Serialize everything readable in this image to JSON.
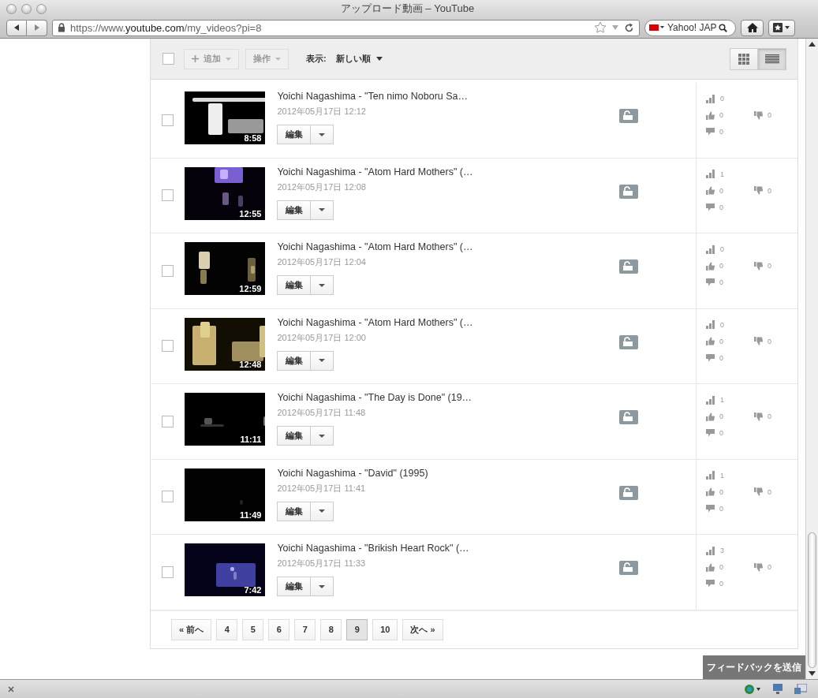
{
  "window": {
    "title": "アップロード動画 – YouTube"
  },
  "browser": {
    "url": "https://www.**youtube.com**/my_videos?pi=8",
    "search": "Yahoo! JAP"
  },
  "toolbar": {
    "select_all_checked": false,
    "add": "追加",
    "actions": "操作",
    "sort_label": "表示:",
    "sort": "新しい順",
    "views": [
      {
        "kind": "grid",
        "selected": false
      },
      {
        "kind": "list",
        "selected": true
      }
    ]
  },
  "videos": [
    {
      "title": "Yoichi Nagashima - \"Ten nimo Noboru Sa…",
      "date": "2012年05月17日 12:12",
      "duration": "8:58",
      "edit": "編集",
      "views": "0",
      "likes": "0",
      "dislikes": "0",
      "comments": "0",
      "checked": false
    },
    {
      "title": "Yoichi Nagashima - \"Atom Hard Mothers\" (…",
      "date": "2012年05月17日 12:08",
      "duration": "12:55",
      "edit": "編集",
      "views": "1",
      "likes": "0",
      "dislikes": "0",
      "comments": "0",
      "checked": false
    },
    {
      "title": "Yoichi Nagashima - \"Atom Hard Mothers\" (…",
      "date": "2012年05月17日 12:04",
      "duration": "12:59",
      "edit": "編集",
      "views": "0",
      "likes": "0",
      "dislikes": "0",
      "comments": "0",
      "checked": false
    },
    {
      "title": "Yoichi Nagashima - \"Atom Hard Mothers\" (…",
      "date": "2012年05月17日 12:00",
      "duration": "12:48",
      "edit": "編集",
      "views": "0",
      "likes": "0",
      "dislikes": "0",
      "comments": "0",
      "checked": false
    },
    {
      "title": "Yoichi Nagashima - \"The Day is Done\" (19…",
      "date": "2012年05月17日 11:48",
      "duration": "11:11",
      "edit": "編集",
      "views": "1",
      "likes": "0",
      "dislikes": "0",
      "comments": "0",
      "checked": false
    },
    {
      "title": "Yoichi Nagashima - \"David\" (1995)",
      "date": "2012年05月17日 11:41",
      "duration": "11:49",
      "edit": "編集",
      "views": "1",
      "likes": "0",
      "dislikes": "0",
      "comments": "0",
      "checked": false
    },
    {
      "title": "Yoichi Nagashima - \"Brikish Heart Rock\" (…",
      "date": "2012年05月17日 11:33",
      "duration": "7:42",
      "edit": "編集",
      "views": "3",
      "likes": "0",
      "dislikes": "0",
      "comments": "0",
      "checked": false
    }
  ],
  "pagination": {
    "prev": "« 前へ",
    "next": "次へ »",
    "pages": [
      {
        "label": "4",
        "selected": false
      },
      {
        "label": "5",
        "selected": false
      },
      {
        "label": "6",
        "selected": false
      },
      {
        "label": "7",
        "selected": false
      },
      {
        "label": "8",
        "selected": false
      },
      {
        "label": "9",
        "selected": true
      },
      {
        "label": "10",
        "selected": false
      }
    ]
  },
  "feedback": "フィードバックを送信"
}
